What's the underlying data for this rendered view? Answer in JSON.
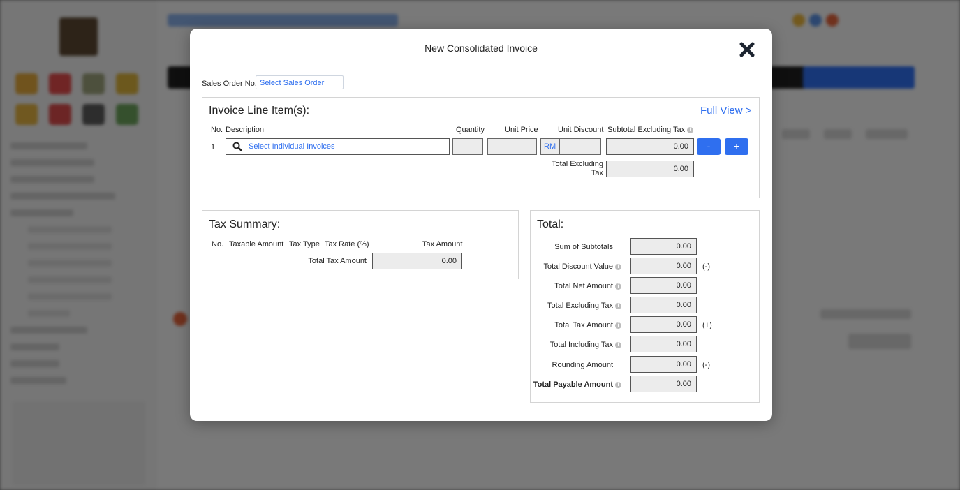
{
  "modal": {
    "title": "New Consolidated Invoice",
    "close_icon": "close-icon"
  },
  "sales_order": {
    "label": "Sales Order No.",
    "placeholder": "Select Sales Order"
  },
  "line_items": {
    "title": "Invoice Line Item(s):",
    "full_view": "Full View >",
    "headers": {
      "no": "No.",
      "description": "Description",
      "quantity": "Quantity",
      "unit_price": "Unit Price",
      "unit_discount": "Unit Discount",
      "subtotal_excl_tax": "Subtotal Excluding Tax"
    },
    "rows": [
      {
        "no": "1",
        "description_placeholder": "Select Individual Invoices",
        "currency": "RM",
        "subtotal": "0.00"
      }
    ],
    "remove_label": "-",
    "add_label": "+",
    "total_excl_tax_label": "Total Excluding Tax",
    "total_excl_tax": "0.00"
  },
  "tax_summary": {
    "title": "Tax Summary:",
    "headers": {
      "no": "No.",
      "taxable_amount": "Taxable Amount",
      "tax_type": "Tax Type",
      "tax_rate": "Tax Rate (%)",
      "tax_amount": "Tax Amount"
    },
    "total_label": "Total Tax Amount",
    "total_value": "0.00"
  },
  "totals": {
    "title": "Total:",
    "rows": [
      {
        "label": "Sum of Subtotals",
        "value": "0.00",
        "suffix": ""
      },
      {
        "label": "Total Discount Value",
        "value": "0.00",
        "suffix": "(-)"
      },
      {
        "label": "Total Net Amount",
        "value": "0.00",
        "suffix": ""
      },
      {
        "label": "Total Excluding Tax",
        "value": "0.00",
        "suffix": ""
      },
      {
        "label": "Total Tax Amount",
        "value": "0.00",
        "suffix": "(+)"
      },
      {
        "label": "Total Including Tax",
        "value": "0.00",
        "suffix": ""
      },
      {
        "label": "Rounding Amount",
        "value": "0.00",
        "suffix": "(-)"
      },
      {
        "label": "Total Payable Amount",
        "value": "0.00",
        "suffix": ""
      }
    ]
  },
  "colors": {
    "accent": "#2f6fef",
    "field_bg": "#ececec",
    "overlay": "#7d7d7d"
  }
}
